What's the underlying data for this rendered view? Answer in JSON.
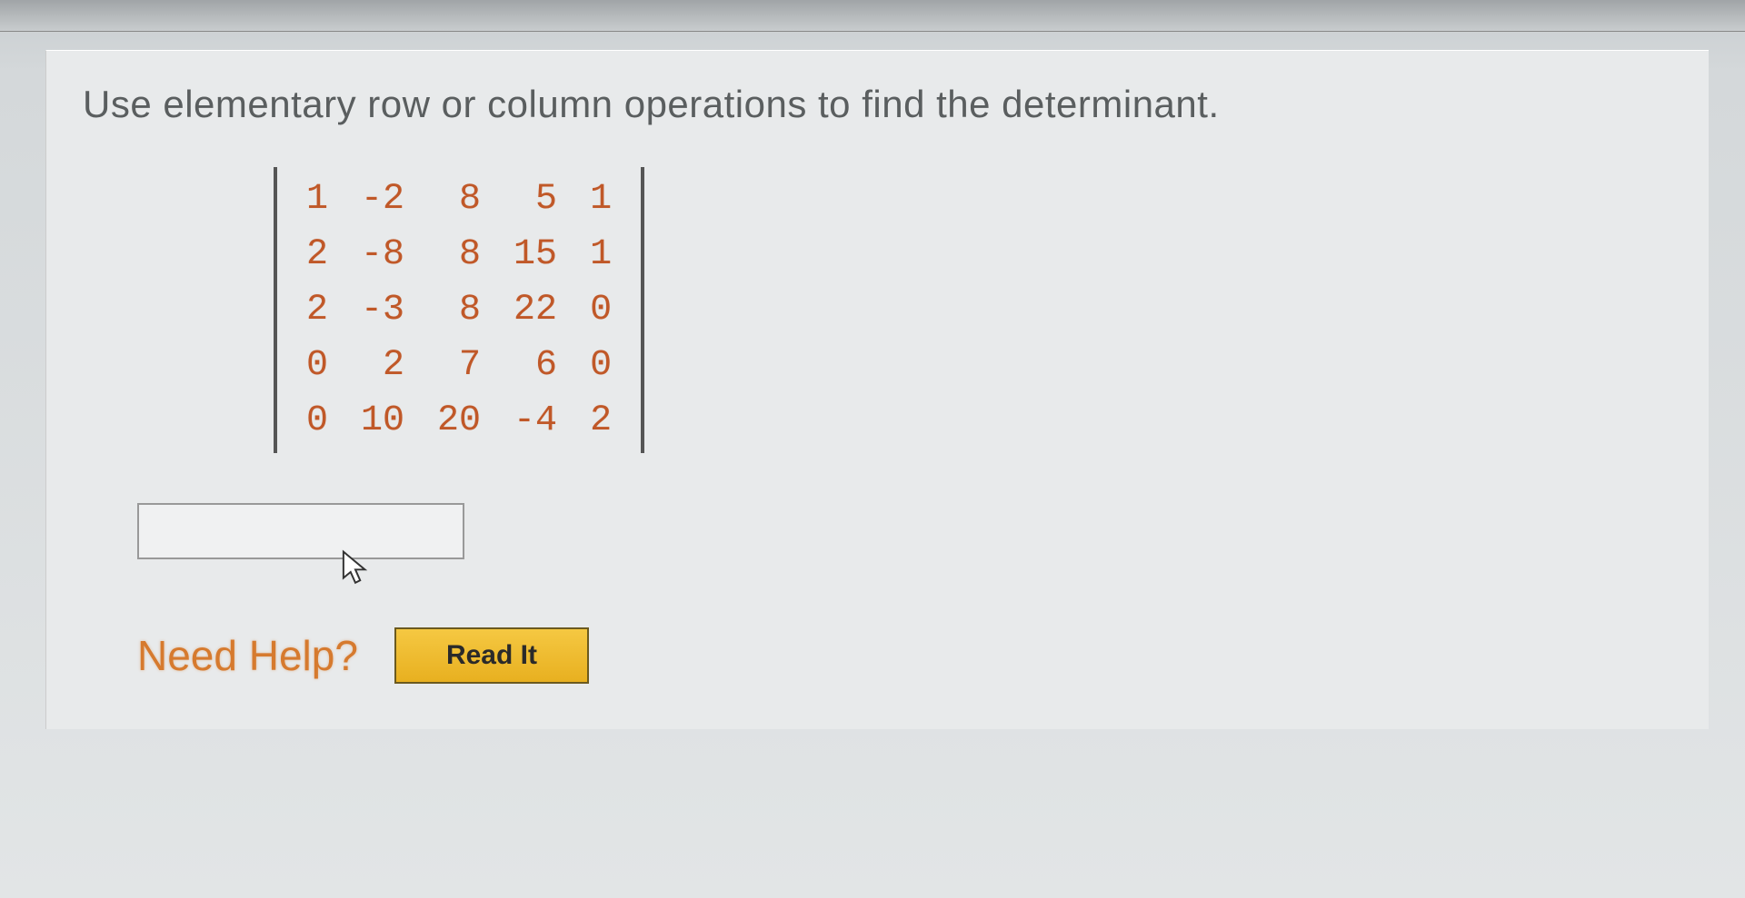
{
  "question": {
    "text": "Use elementary row or column operations to find the determinant."
  },
  "matrix": {
    "r0c0": "1",
    "r0c1": "-2",
    "r0c2": "8",
    "r0c3": "5",
    "r0c4": "1",
    "r1c0": "2",
    "r1c1": "-8",
    "r1c2": "8",
    "r1c3": "15",
    "r1c4": "1",
    "r2c0": "2",
    "r2c1": "-3",
    "r2c2": "8",
    "r2c3": "22",
    "r2c4": "0",
    "r3c0": "0",
    "r3c1": "2",
    "r3c2": "7",
    "r3c3": "6",
    "r3c4": "0",
    "r4c0": "0",
    "r4c1": "10",
    "r4c2": "20",
    "r4c3": "-4",
    "r4c4": "2"
  },
  "answer": {
    "value": "",
    "placeholder": ""
  },
  "help": {
    "label": "Need Help?",
    "read_button": "Read It"
  }
}
